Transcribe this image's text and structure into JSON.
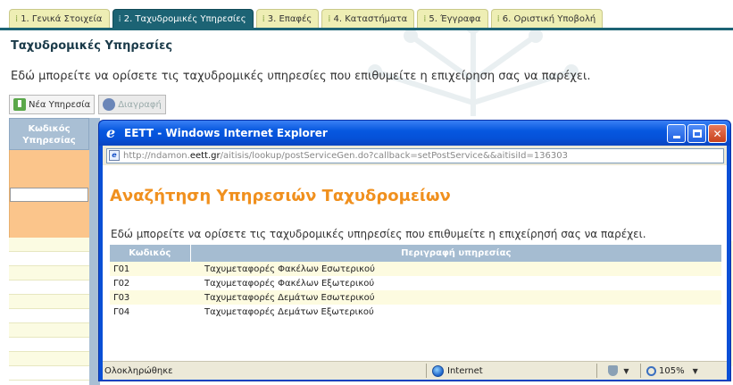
{
  "tabs": [
    {
      "label": "1. Γενικά Στοιχεία",
      "active": false
    },
    {
      "label": "2. Ταχυδρομικές Υπηρεσίες",
      "active": true
    },
    {
      "label": "3. Επαφές",
      "active": false
    },
    {
      "label": "4. Καταστήματα",
      "active": false
    },
    {
      "label": "5. Έγγραφα",
      "active": false
    },
    {
      "label": "6. Οριστική Υποβολή",
      "active": false
    }
  ],
  "page": {
    "title": "Ταχυδρομικές Υπηρεσίες",
    "description": "Εδώ μπορείτε να ορίσετε τις ταχυδρομικές υπηρεσίες που επιθυμείτε η επιχείρηση σας να παρέχει.",
    "toolbar": {
      "new_label": "Νέα Υπηρεσία",
      "delete_label": "Διαγραφή"
    },
    "grid_header": "Κωδικός Υπηρεσίας"
  },
  "popup": {
    "window_title": "EETT - Windows Internet Explorer",
    "address_prefix": "http://ndamon.",
    "address_domain": "eett.gr",
    "address_suffix": "/aitisis/lookup/postServiceGen.do?callback=setPostService&&aitisiId=136303",
    "heading": "Αναζήτηση Υπηρεσιών Ταχυδρομείων",
    "description": "Εδώ μπορείτε να ορίσετε τις ταχυδρομικές υπηρεσίες που επιθυμείτε η επιχείρησή σας να παρέχει.",
    "table": {
      "headers": [
        "Κωδικός",
        "Περιγραφή υπηρεσίας"
      ],
      "rows": [
        [
          "Γ01",
          "Ταχυμεταφορές Φακέλων Εσωτερικού"
        ],
        [
          "Γ02",
          "Ταχυμεταφορές Φακέλων Εξωτερικού"
        ],
        [
          "Γ03",
          "Ταχυμεταφορές Δεμάτων Εσωτερικού"
        ],
        [
          "Γ04",
          "Ταχυμεταφορές Δεμάτων Εξωτερικού"
        ]
      ]
    },
    "status": {
      "text": "Ολοκληρώθηκε",
      "zone": "Internet",
      "zoom": "105%"
    }
  },
  "colors": {
    "tab_active": "#1c6374",
    "tab_inactive": "#eeeeb4",
    "popup_heading": "#f0901e",
    "table_header": "#a5bcd1",
    "xp_title": "#0558e0"
  }
}
